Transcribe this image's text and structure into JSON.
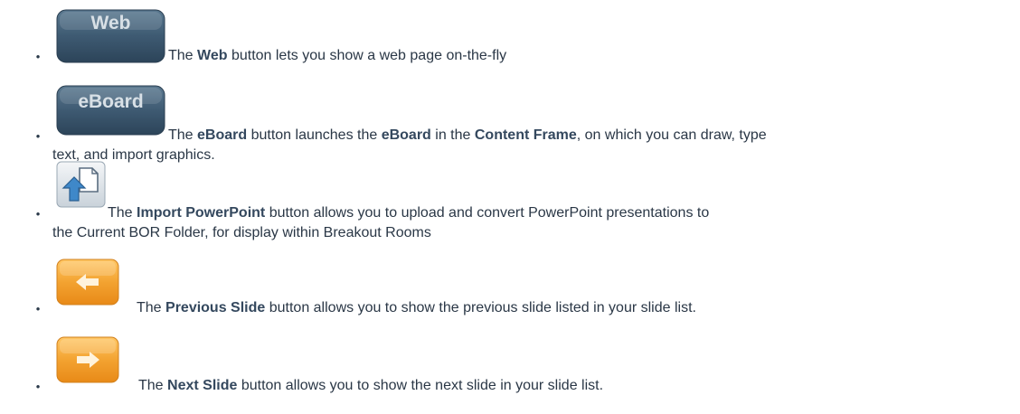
{
  "items": [
    {
      "icon_label": "Web",
      "pre": "The ",
      "bold1": "Web",
      "mid1": " button lets you show a web page on-the-fly",
      "bold2": "",
      "mid2": "",
      "bold3": "",
      "post": "",
      "cont": ""
    },
    {
      "icon_label": "eBoard",
      "pre": "The ",
      "bold1": "eBoard",
      "mid1": " button launches the ",
      "bold2": "eBoard",
      "mid2": " in the ",
      "bold3": "Content Frame",
      "post": ", on which you can draw, type",
      "cont": "text, and import graphics."
    },
    {
      "icon_label": "",
      "pre": "The ",
      "bold1": "Import PowerPoint",
      "mid1": " button allows you to upload and convert PowerPoint presentations to",
      "bold2": "",
      "mid2": "",
      "bold3": "",
      "post": "",
      "cont": "the Current BOR Folder, for display within Breakout Rooms"
    },
    {
      "icon_label": "",
      "pre": "The ",
      "bold1": "Previous Slide",
      "mid1": " button allows you to show the previous slide listed in your slide list.",
      "bold2": "",
      "mid2": "",
      "bold3": "",
      "post": "",
      "cont": ""
    },
    {
      "icon_label": "",
      "pre": "The ",
      "bold1": "Next Slide",
      "mid1": " button allows you to show the next slide in your slide list.",
      "bold2": "",
      "mid2": "",
      "bold3": "",
      "post": "",
      "cont": ""
    }
  ],
  "bullet": "•",
  "colors": {
    "dark_button": "#3a556c",
    "orange_button": "#f0a02a",
    "text": "#2a3746"
  }
}
